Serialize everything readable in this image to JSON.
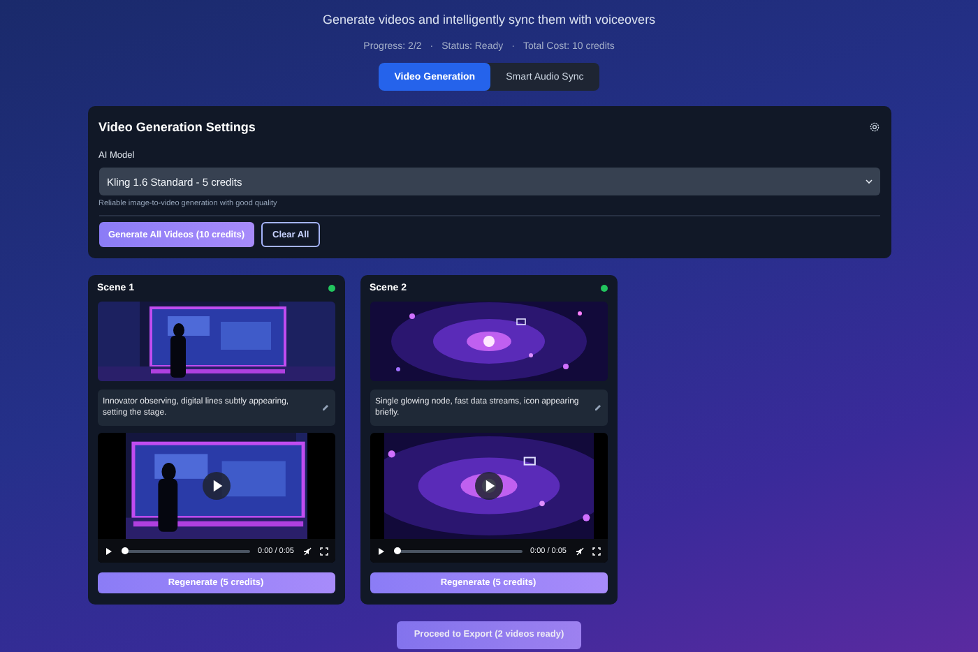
{
  "header": {
    "subtitle": "Generate videos and intelligently sync them with voiceovers",
    "stats": [
      "Progress: 2/2",
      "Status: Ready",
      "Total Cost: 10 credits"
    ],
    "separator": "·"
  },
  "tabs": [
    {
      "label": "Video Generation",
      "selected": true
    },
    {
      "label": "Smart Audio Sync",
      "selected": false
    }
  ],
  "settings": {
    "title": "Video Generation Settings",
    "model_label": "AI Model",
    "model_value": "Kling 1.6 Standard - 5 credits",
    "model_hint": "Reliable image-to-video generation with good quality",
    "buttons": [
      {
        "label": "Generate All Videos (10 credits)",
        "kind": "primary"
      },
      {
        "label": "Clear All",
        "kind": "outline"
      }
    ]
  },
  "scenes": [
    {
      "title": "Scene 1",
      "ready": true,
      "description": "Innovator observing, digital lines subtly appearing, setting the stage.",
      "time": "0:00 / 0:05",
      "regenerate": "Regenerate (5 credits)"
    },
    {
      "title": "Scene 2",
      "ready": true,
      "description": "Single glowing node, fast data streams, icon appearing briefly.",
      "time": "0:00 / 0:05",
      "regenerate": "Regenerate (5 credits)"
    }
  ],
  "footer_button": "Proceed to Export (2 videos ready)"
}
